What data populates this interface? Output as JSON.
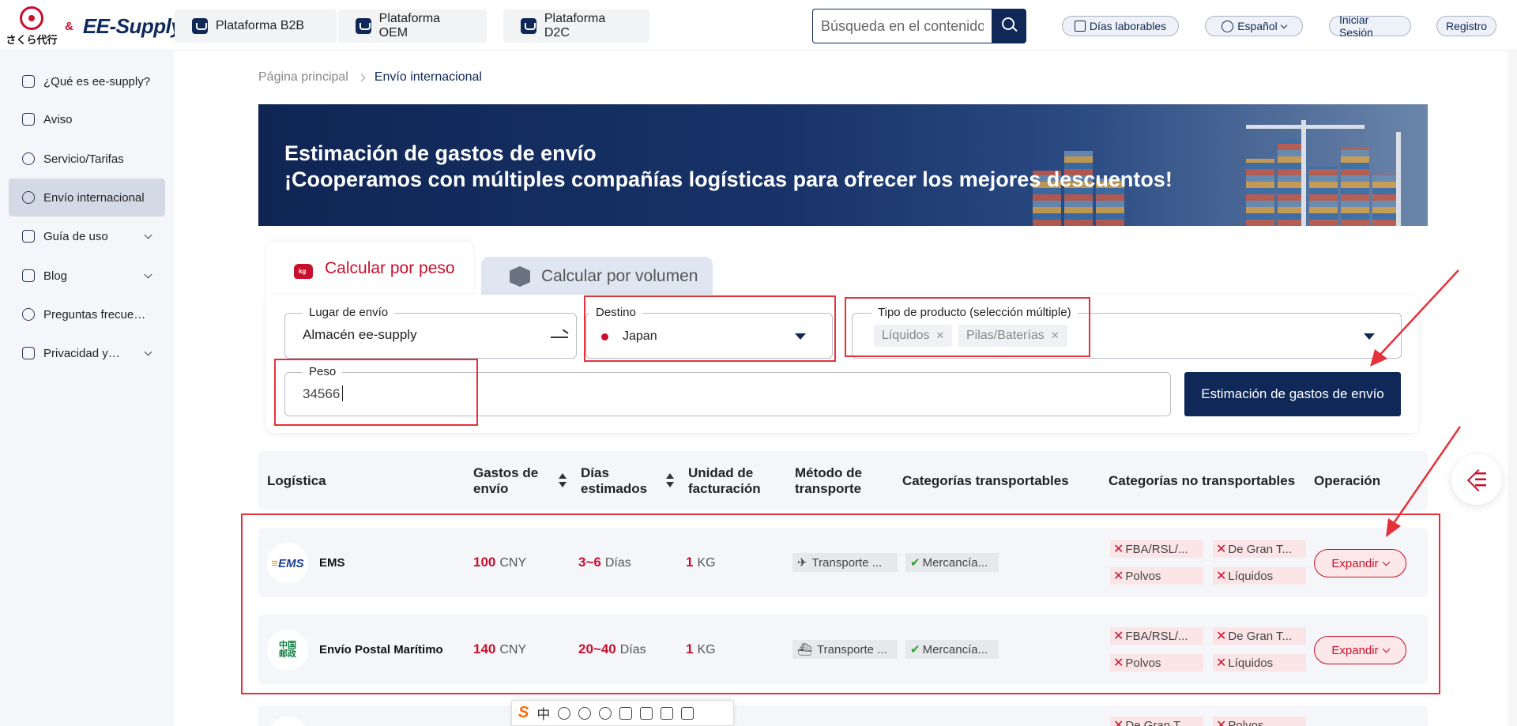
{
  "logo": {
    "jp_text": "さくら代行",
    "amp": "&",
    "brand": "EE-Supply"
  },
  "platform_tabs": [
    {
      "label": "Plataforma B2B"
    },
    {
      "label": "Plataforma OEM"
    },
    {
      "label": "Plataforma D2C"
    }
  ],
  "search": {
    "placeholder": "Búsqueda en el contenido del sitio"
  },
  "header_actions": {
    "workdays": "Días laborables",
    "language": "Español",
    "login": "Iniciar Sesión",
    "register": "Registro"
  },
  "sidebar": {
    "items": [
      {
        "label": "¿Qué es ee-supply?",
        "icon": "home-icon"
      },
      {
        "label": "Aviso",
        "icon": "megaphone-icon"
      },
      {
        "label": "Servicio/Tarifas",
        "icon": "yen-icon"
      },
      {
        "label": "Envío internacional",
        "icon": "globe-icon",
        "active": true
      },
      {
        "label": "Guía de uso",
        "icon": "guide-icon"
      },
      {
        "label": "Blog",
        "icon": "blog-icon"
      },
      {
        "label": "Preguntas frecuentes",
        "icon": "shield-icon"
      },
      {
        "label": "Privacidad y seguridad",
        "icon": "document-icon"
      }
    ]
  },
  "breadcrumb": {
    "home": "Página principal",
    "current": "Envío internacional"
  },
  "banner": {
    "line1": "Estimación de gastos de envío",
    "line2": "¡Cooperamos con múltiples compañías logísticas para ofrecer los mejores descuentos!"
  },
  "calc_tabs": {
    "by_weight": "Calcular por peso",
    "by_volume": "Calcular por volumen"
  },
  "form": {
    "origin_label": "Lugar de envío",
    "origin_value": "Almacén ee-supply",
    "destination_label": "Destino",
    "destination_value": "Japan",
    "product_type_label": "Tipo de producto (selección múltiple)",
    "product_tags": [
      "Líquidos",
      "Pilas/Baterías"
    ],
    "weight_label": "Peso",
    "weight_value": "34566",
    "estimate_button": "Estimación de gastos de envío"
  },
  "table": {
    "headers": {
      "logistics": "Logística",
      "cost": "Gastos de envío",
      "days": "Días estimados",
      "unit": "Unidad de facturación",
      "method": "Método de transporte",
      "allowed": "Categorías transportables",
      "not_allowed": "Categorías no transportables",
      "operation": "Operación"
    },
    "rows": [
      {
        "carrier": "EMS",
        "cost": "100",
        "cost_unit": "CNY",
        "days": "3~6",
        "days_unit": "Días",
        "billing": "1",
        "billing_unit": "KG",
        "method": "Transporte ...",
        "allowed": "Mercancía...",
        "not_allowed": [
          "FBA/RSL/...",
          "De Gran T...",
          "Polvos",
          "Líquidos"
        ],
        "action": "Expandir"
      },
      {
        "carrier": "Envío Postal Marítimo",
        "cost": "140",
        "cost_unit": "CNY",
        "days": "20~40",
        "days_unit": "Días",
        "billing": "1",
        "billing_unit": "KG",
        "method": "Transporte ...",
        "allowed": "Mercancía...",
        "not_allowed": [
          "FBA/RSL/...",
          "De Gran T...",
          "Polvos",
          "Líquidos"
        ],
        "action": "Expandir"
      },
      {
        "not_allowed": [
          "De Gran T...",
          "Polvos"
        ]
      }
    ]
  },
  "ime_toolbar": {
    "s": "S",
    "zh": "中"
  },
  "colors": {
    "navy": "#0f2858",
    "accent_red": "#c8102e",
    "annotation_red": "#e5313a"
  }
}
